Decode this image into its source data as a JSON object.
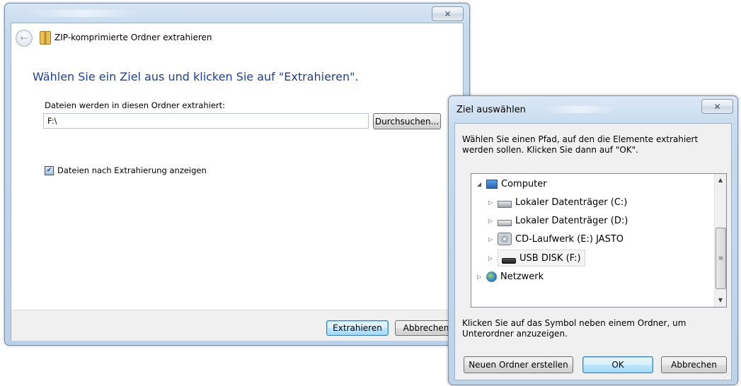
{
  "main_window": {
    "header_title": "ZIP-komprimierte Ordner extrahieren",
    "close_symbol": "✕",
    "back_symbol": "←",
    "instruction": "Wählen Sie ein Ziel aus und klicken Sie auf \"Extrahieren\".",
    "folder_label": "Dateien werden in diesen Ordner extrahiert:",
    "path_value": "F:\\",
    "browse_label": "Durchsuchen...",
    "checkbox_label": "Dateien nach Extrahierung anzeigen",
    "checkbox_checked": true,
    "checkbox_mark": "✔",
    "extract_label": "Extrahieren",
    "cancel_label": "Abbrechen"
  },
  "picker_window": {
    "title": "Ziel auswählen",
    "close_symbol": "✕",
    "description": "Wählen Sie einen Pfad, auf den die Elemente extrahiert werden sollen. Klicken Sie dann auf \"OK\".",
    "tree": [
      {
        "label": "Computer",
        "icon": "computer-icon",
        "arrow": "◢",
        "level": 0
      },
      {
        "label": "Lokaler Datenträger (C:)",
        "icon": "drive-c-icon",
        "arrow": "▷",
        "level": 1
      },
      {
        "label": "Lokaler Datenträger (D:)",
        "icon": "drive-icon",
        "arrow": "▷",
        "level": 1
      },
      {
        "label": "CD-Laufwerk (E:) JASTO",
        "icon": "cd-drive-icon",
        "arrow": "▷",
        "level": 1
      },
      {
        "label": "USB DISK (F:)",
        "icon": "usb-drive-icon",
        "arrow": "▷",
        "level": 1,
        "selected": true
      },
      {
        "label": "Netzwerk",
        "icon": "network-icon",
        "arrow": "▷",
        "level": 0
      }
    ],
    "scroll_up": "▲",
    "scroll_down": "▼",
    "scroll_grip": "≡",
    "hint": "Klicken Sie auf das Symbol neben einem Ordner, um Unterordner anzuzeigen.",
    "new_folder_label": "Neuen Ordner erstellen",
    "ok_label": "OK",
    "cancel_label": "Abbrechen"
  }
}
